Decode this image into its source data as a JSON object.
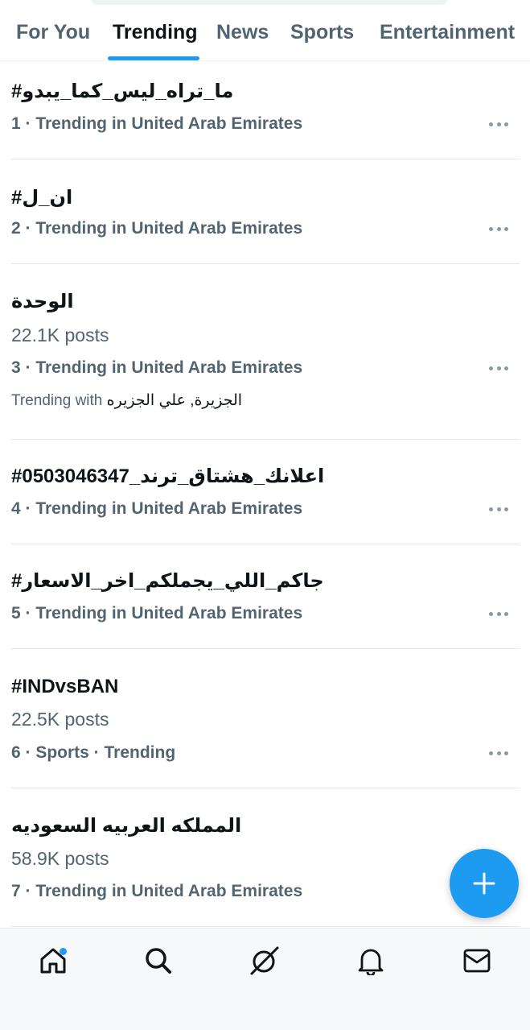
{
  "tabs": [
    {
      "label": "For You",
      "active": false
    },
    {
      "label": "Trending",
      "active": true
    },
    {
      "label": "News",
      "active": false
    },
    {
      "label": "Sports",
      "active": false
    },
    {
      "label": "Entertainment",
      "active": false
    }
  ],
  "trends": [
    {
      "title": "#ما_تراه_ليس_كما_يبدو",
      "posts": "",
      "context": "1 · Trending in United Arab Emirates",
      "with_label": "",
      "with_names": ""
    },
    {
      "title": "#ان_ل",
      "posts": "",
      "context": "2 · Trending in United Arab Emirates",
      "with_label": "",
      "with_names": ""
    },
    {
      "title": "الوحدة",
      "posts": "22.1K posts",
      "context": "3 · Trending in United Arab Emirates",
      "with_label": "Trending with",
      "with_names": "الجزيرة, علي الجزيره"
    },
    {
      "title": "#اعلانك_هشتاق_ترند_0503046347",
      "posts": "",
      "context": "4 · Trending in United Arab Emirates",
      "with_label": "",
      "with_names": ""
    },
    {
      "title": "#جاكم_اللي_يجملكم_اخر_الاسعار",
      "posts": "",
      "context": "5 · Trending in United Arab Emirates",
      "with_label": "",
      "with_names": ""
    },
    {
      "title": "#INDvsBAN",
      "posts": "22.5K posts",
      "context": "6 · Sports · Trending",
      "with_label": "",
      "with_names": ""
    },
    {
      "title": "المملكه العربيه السعوديه",
      "posts": "58.9K posts",
      "context": "7 · Trending in United Arab Emirates",
      "with_label": "",
      "with_names": ""
    }
  ],
  "fab": {
    "icon": "plus-icon"
  },
  "bottom_nav": [
    {
      "name": "home",
      "icon": "home-icon",
      "active": true,
      "notification_dot": true
    },
    {
      "name": "search",
      "icon": "search-icon",
      "active": false,
      "notification_dot": false
    },
    {
      "name": "grok",
      "icon": "grok-icon",
      "active": false,
      "notification_dot": false
    },
    {
      "name": "notifications",
      "icon": "bell-icon",
      "active": false,
      "notification_dot": false
    },
    {
      "name": "messages",
      "icon": "mail-icon",
      "active": false,
      "notification_dot": false
    }
  ],
  "colors": {
    "accent": "#1d9bf0",
    "text_primary": "#0f1419",
    "text_secondary": "#536471",
    "divider": "#e3e7ea"
  }
}
